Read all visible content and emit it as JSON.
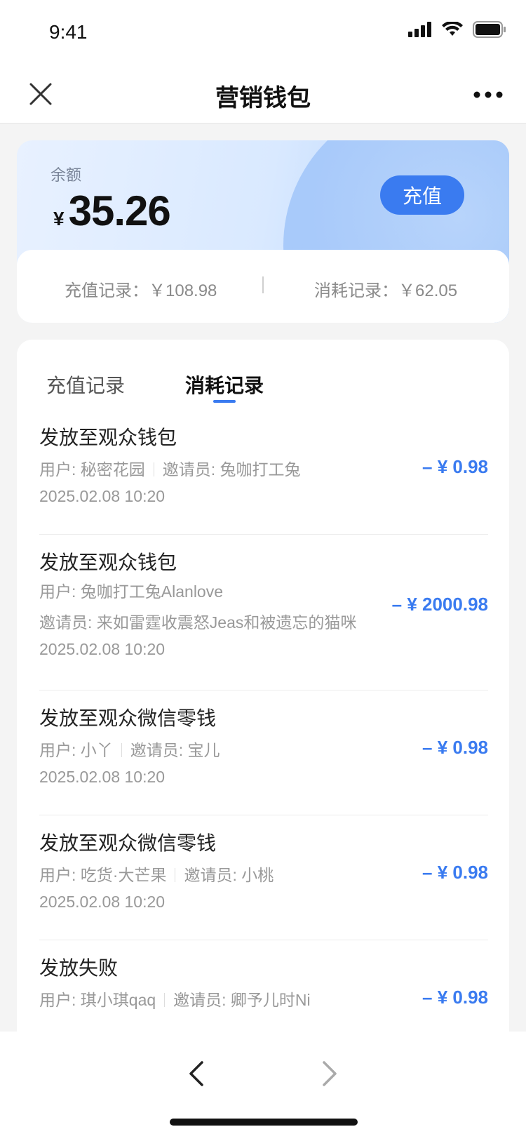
{
  "status_bar": {
    "time": "9:41"
  },
  "nav": {
    "title": "营销钱包"
  },
  "balance": {
    "label": "余额",
    "currency": "¥",
    "amount": "35.26",
    "recharge_label": "充值"
  },
  "summary": {
    "recharge": "充值记录：￥108.98",
    "consume": "消耗记录：￥62.05"
  },
  "tabs": [
    {
      "label": "充值记录"
    },
    {
      "label": "消耗记录"
    }
  ],
  "records": [
    {
      "title": "发放至观众钱包",
      "user": "用户: 秘密花园",
      "inviter": "邀请员: 兔咖打工兔",
      "date": "2025.02.08 10:20",
      "amount": "– ¥ 0.98"
    },
    {
      "title": "发放至观众钱包",
      "user": "用户: 兔咖打工兔Alanlove",
      "inviter": "邀请员: 来如雷霆收震怒Jeas和被遗忘的猫咪",
      "date": "2025.02.08 10:20",
      "amount": "– ¥ 2000.98"
    },
    {
      "title": "发放至观众微信零钱",
      "user": "用户: 小丫",
      "inviter": "邀请员: 宝儿",
      "date": "2025.02.08 10:20",
      "amount": "– ¥ 0.98"
    },
    {
      "title": "发放至观众微信零钱",
      "user": "用户: 吃货·大芒果",
      "inviter": "邀请员: 小桃",
      "date": "2025.02.08 10:20",
      "amount": "– ¥ 0.98"
    },
    {
      "title": "发放失败",
      "user": "用户: 琪小琪qaq",
      "inviter": "邀请员: 卿予儿时Ni",
      "amount": "– ¥ 0.98"
    }
  ],
  "colors": {
    "accent": "#3a7bf0"
  }
}
